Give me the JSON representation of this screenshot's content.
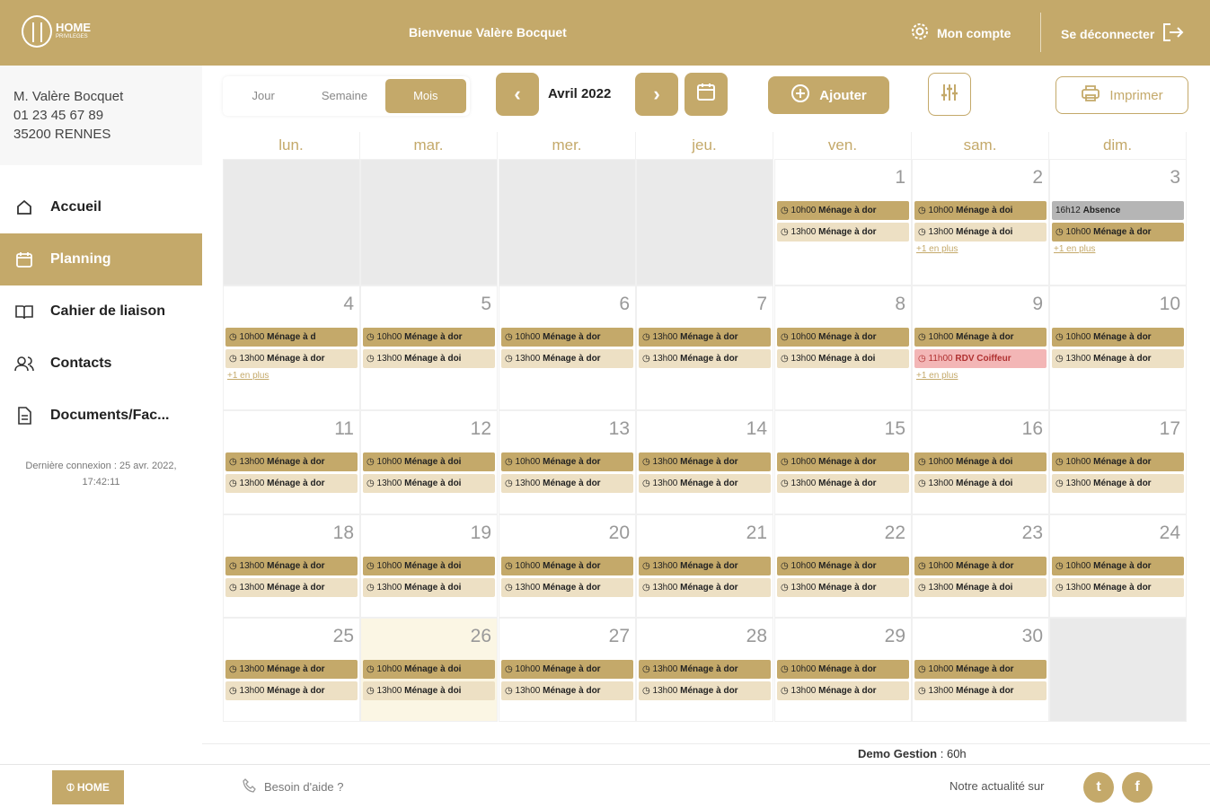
{
  "header": {
    "logo_text": "HOME",
    "logo_sub": "PRIVILEGES",
    "welcome": "Bienvenue Valère Bocquet",
    "account_label": "Mon compte",
    "logout_label": "Se déconnecter"
  },
  "sidebar": {
    "user": {
      "name": "M. Valère Bocquet",
      "phone": "01 23 45 67 89",
      "city": "35200 RENNES"
    },
    "items": [
      {
        "label": "Accueil",
        "icon": "home-icon"
      },
      {
        "label": "Planning",
        "icon": "calendar-icon",
        "active": true
      },
      {
        "label": "Cahier de liaison",
        "icon": "book-icon"
      },
      {
        "label": "Contacts",
        "icon": "contacts-icon"
      },
      {
        "label": "Documents/Fac...",
        "icon": "document-icon"
      }
    ],
    "last_login": "Dernière connexion : 25 avr. 2022, 17:42:11"
  },
  "toolbar": {
    "views": [
      "Jour",
      "Semaine",
      "Mois"
    ],
    "active_view": "Mois",
    "month_label": "Avril 2022",
    "add_label": "Ajouter",
    "print_label": "Imprimer"
  },
  "calendar": {
    "weekdays": [
      "lun.",
      "mar.",
      "mer.",
      "jeu.",
      "ven.",
      "sam.",
      "dim."
    ],
    "weeks": [
      [
        {
          "day": "",
          "out": true,
          "events": []
        },
        {
          "day": "",
          "out": true,
          "events": []
        },
        {
          "day": "",
          "out": true,
          "events": []
        },
        {
          "day": "",
          "out": true,
          "events": []
        },
        {
          "day": "1",
          "events": [
            {
              "t": "10h00",
              "l": "Ménage à dor",
              "s": "dark"
            },
            {
              "t": "13h00",
              "l": "Ménage à dor",
              "s": "light"
            }
          ]
        },
        {
          "day": "2",
          "events": [
            {
              "t": "10h00",
              "l": "Ménage à doi",
              "s": "dark"
            },
            {
              "t": "13h00",
              "l": "Ménage à doi",
              "s": "light"
            }
          ],
          "more": "+1 en plus"
        },
        {
          "day": "3",
          "events": [
            {
              "t": "16h12",
              "l": "Absence",
              "s": "gray"
            },
            {
              "t": "10h00",
              "l": "Ménage à dor",
              "s": "dark"
            }
          ],
          "more": "+1 en plus"
        }
      ],
      [
        {
          "day": "4",
          "events": [
            {
              "t": "10h00",
              "l": "Ménage à d",
              "s": "dark"
            },
            {
              "t": "13h00",
              "l": "Ménage à dor",
              "s": "light"
            }
          ],
          "more": "+1 en plus"
        },
        {
          "day": "5",
          "events": [
            {
              "t": "10h00",
              "l": "Ménage à dor",
              "s": "dark"
            },
            {
              "t": "13h00",
              "l": "Ménage à doi",
              "s": "light"
            }
          ]
        },
        {
          "day": "6",
          "events": [
            {
              "t": "10h00",
              "l": "Ménage à dor",
              "s": "dark"
            },
            {
              "t": "13h00",
              "l": "Ménage à dor",
              "s": "light"
            }
          ]
        },
        {
          "day": "7",
          "events": [
            {
              "t": "13h00",
              "l": "Ménage à dor",
              "s": "dark"
            },
            {
              "t": "13h00",
              "l": "Ménage à dor",
              "s": "light"
            }
          ]
        },
        {
          "day": "8",
          "events": [
            {
              "t": "10h00",
              "l": "Ménage à dor",
              "s": "dark"
            },
            {
              "t": "13h00",
              "l": "Ménage à doi",
              "s": "light"
            }
          ]
        },
        {
          "day": "9",
          "events": [
            {
              "t": "10h00",
              "l": "Ménage à dor",
              "s": "dark"
            },
            {
              "t": "11h00",
              "l": "RDV Coiffeur",
              "s": "pink"
            }
          ],
          "more": "+1 en plus"
        },
        {
          "day": "10",
          "events": [
            {
              "t": "10h00",
              "l": "Ménage à dor",
              "s": "dark"
            },
            {
              "t": "13h00",
              "l": "Ménage à dor",
              "s": "light"
            }
          ]
        }
      ],
      [
        {
          "day": "11",
          "events": [
            {
              "t": "13h00",
              "l": "Ménage à dor",
              "s": "dark"
            },
            {
              "t": "13h00",
              "l": "Ménage à dor",
              "s": "light"
            }
          ]
        },
        {
          "day": "12",
          "events": [
            {
              "t": "10h00",
              "l": "Ménage à doi",
              "s": "dark"
            },
            {
              "t": "13h00",
              "l": "Ménage à doi",
              "s": "light"
            }
          ]
        },
        {
          "day": "13",
          "events": [
            {
              "t": "10h00",
              "l": "Ménage à dor",
              "s": "dark"
            },
            {
              "t": "13h00",
              "l": "Ménage à dor",
              "s": "light"
            }
          ]
        },
        {
          "day": "14",
          "events": [
            {
              "t": "13h00",
              "l": "Ménage à dor",
              "s": "dark"
            },
            {
              "t": "13h00",
              "l": "Ménage à dor",
              "s": "light"
            }
          ]
        },
        {
          "day": "15",
          "events": [
            {
              "t": "10h00",
              "l": "Ménage à dor",
              "s": "dark"
            },
            {
              "t": "13h00",
              "l": "Ménage à dor",
              "s": "light"
            }
          ]
        },
        {
          "day": "16",
          "events": [
            {
              "t": "10h00",
              "l": "Ménage à doi",
              "s": "dark"
            },
            {
              "t": "13h00",
              "l": "Ménage à doi",
              "s": "light"
            }
          ]
        },
        {
          "day": "17",
          "events": [
            {
              "t": "10h00",
              "l": "Ménage à dor",
              "s": "dark"
            },
            {
              "t": "13h00",
              "l": "Ménage à dor",
              "s": "light"
            }
          ]
        }
      ],
      [
        {
          "day": "18",
          "events": [
            {
              "t": "13h00",
              "l": "Ménage à dor",
              "s": "dark"
            },
            {
              "t": "13h00",
              "l": "Ménage à dor",
              "s": "light"
            }
          ]
        },
        {
          "day": "19",
          "events": [
            {
              "t": "10h00",
              "l": "Ménage à doi",
              "s": "dark"
            },
            {
              "t": "13h00",
              "l": "Ménage à doi",
              "s": "light"
            }
          ]
        },
        {
          "day": "20",
          "events": [
            {
              "t": "10h00",
              "l": "Ménage à dor",
              "s": "dark"
            },
            {
              "t": "13h00",
              "l": "Ménage à dor",
              "s": "light"
            }
          ]
        },
        {
          "day": "21",
          "events": [
            {
              "t": "13h00",
              "l": "Ménage à dor",
              "s": "dark"
            },
            {
              "t": "13h00",
              "l": "Ménage à dor",
              "s": "light"
            }
          ]
        },
        {
          "day": "22",
          "events": [
            {
              "t": "10h00",
              "l": "Ménage à dor",
              "s": "dark"
            },
            {
              "t": "13h00",
              "l": "Ménage à dor",
              "s": "light"
            }
          ]
        },
        {
          "day": "23",
          "events": [
            {
              "t": "10h00",
              "l": "Ménage à dor",
              "s": "dark"
            },
            {
              "t": "13h00",
              "l": "Ménage à doi",
              "s": "light"
            }
          ]
        },
        {
          "day": "24",
          "events": [
            {
              "t": "10h00",
              "l": "Ménage à dor",
              "s": "dark"
            },
            {
              "t": "13h00",
              "l": "Ménage à dor",
              "s": "light"
            }
          ]
        }
      ],
      [
        {
          "day": "25",
          "events": [
            {
              "t": "13h00",
              "l": "Ménage à dor",
              "s": "dark"
            },
            {
              "t": "13h00",
              "l": "Ménage à dor",
              "s": "light"
            }
          ]
        },
        {
          "day": "26",
          "today": true,
          "events": [
            {
              "t": "10h00",
              "l": "Ménage à doi",
              "s": "dark"
            },
            {
              "t": "13h00",
              "l": "Ménage à doi",
              "s": "light"
            }
          ]
        },
        {
          "day": "27",
          "events": [
            {
              "t": "10h00",
              "l": "Ménage à dor",
              "s": "dark"
            },
            {
              "t": "13h00",
              "l": "Ménage à dor",
              "s": "light"
            }
          ]
        },
        {
          "day": "28",
          "events": [
            {
              "t": "13h00",
              "l": "Ménage à dor",
              "s": "dark"
            },
            {
              "t": "13h00",
              "l": "Ménage à dor",
              "s": "light"
            }
          ]
        },
        {
          "day": "29",
          "events": [
            {
              "t": "10h00",
              "l": "Ménage à dor",
              "s": "dark"
            },
            {
              "t": "13h00",
              "l": "Ménage à dor",
              "s": "light"
            }
          ]
        },
        {
          "day": "30",
          "events": [
            {
              "t": "10h00",
              "l": "Ménage à dor",
              "s": "dark"
            },
            {
              "t": "13h00",
              "l": "Ménage à dor",
              "s": "light"
            }
          ]
        },
        {
          "day": "",
          "out": true,
          "events": []
        }
      ]
    ]
  },
  "gestion": {
    "label": "Demo Gestion",
    "value": "60h"
  },
  "footer": {
    "help_label": "Besoin d'aide ?",
    "news_label": "Notre actualité sur",
    "twitter": "twitter-icon",
    "facebook": "facebook-icon"
  },
  "colors": {
    "brand": "#c4a96a",
    "event_light": "#ede0c4",
    "absence": "#b5b5b5",
    "rdv": "#f3b6b6",
    "today": "#fbf6e4"
  }
}
